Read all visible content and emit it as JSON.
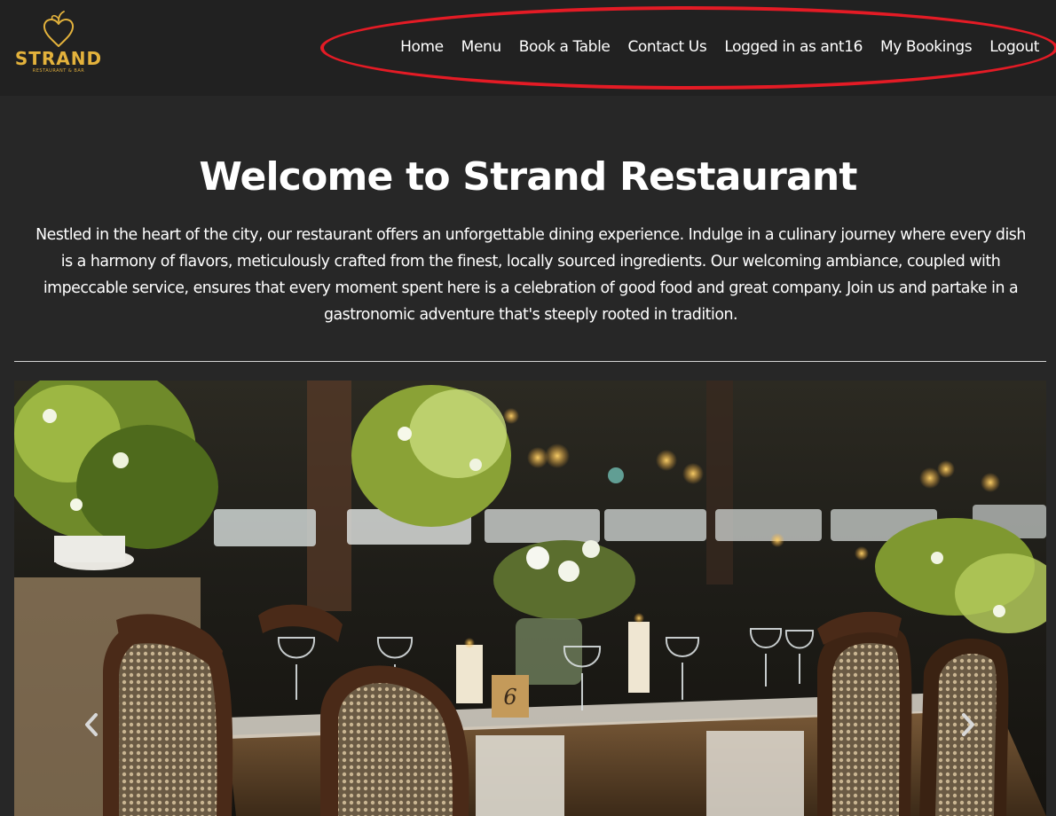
{
  "brand": {
    "name": "STRAND",
    "tagline": "RESTAURANT & BAR",
    "color": "#e3b23c"
  },
  "nav": {
    "items": [
      {
        "label": "Home"
      },
      {
        "label": "Menu"
      },
      {
        "label": "Book a Table"
      },
      {
        "label": "Contact Us"
      },
      {
        "label": "Logged in as ant16"
      },
      {
        "label": "My Bookings"
      },
      {
        "label": "Logout"
      }
    ],
    "highlight_color": "#e41b25"
  },
  "hero": {
    "title": "Welcome to Strand Restaurant",
    "description": "Nestled in the heart of the city, our restaurant offers an unforgettable dining experience. Indulge in a culinary journey where every dish is a harmony of flavors, meticulously crafted from the finest, locally sourced ingredients. Our welcoming ambiance, coupled with impeccable service, ensures that every moment spent here is a celebration of good food and great company. Join us and partake in a gastronomic adventure that's steeply rooted in tradition."
  },
  "carousel": {
    "table_number": "6",
    "prev_icon": "chevron-left-icon",
    "next_icon": "chevron-right-icon"
  },
  "colors": {
    "page_background": "#272727",
    "navbar_background": "#212121",
    "text": "#ffffff"
  }
}
